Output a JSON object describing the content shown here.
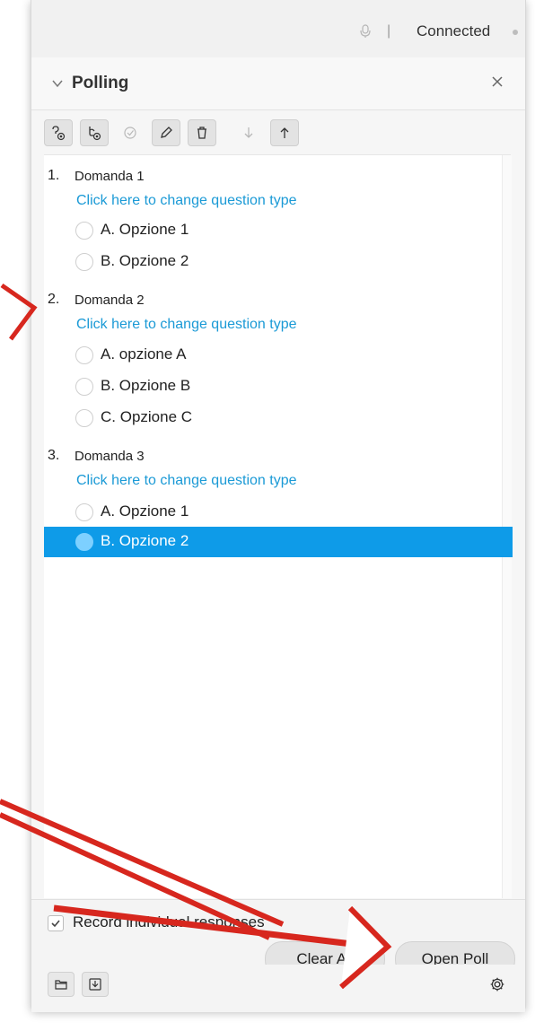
{
  "status": {
    "connection_label": "Connected",
    "separator": "|"
  },
  "header": {
    "title": "Polling"
  },
  "questions": [
    {
      "number": "1.",
      "text": "Domanda 1",
      "link": "Click here to change question type",
      "options": [
        "A. Opzione 1",
        "B. Opzione 2"
      ]
    },
    {
      "number": "2.",
      "text": "Domanda 2",
      "link": "Click here to change question type",
      "options": [
        "A. opzione A",
        "B. Opzione B",
        "C. Opzione C"
      ]
    },
    {
      "number": "3.",
      "text": "Domanda 3",
      "link": "Click here to change question type",
      "options": [
        "A. Opzione 1",
        "B. Opzione 2"
      ],
      "selected_option": "B. Opzione 2"
    }
  ],
  "footer": {
    "record_label": "Record individual responses",
    "record_checked": true,
    "clear_all_label": "Clear All",
    "open_poll_label": "Open Poll"
  },
  "colors": {
    "accent": "#0e9be8",
    "link": "#1b9ad6",
    "annotation_arrow": "#d7271e"
  },
  "icons": {
    "toolbar": [
      "add-question-icon",
      "add-poll-icon",
      "check-icon",
      "edit-icon",
      "delete-icon",
      "move-down-icon",
      "move-up-icon"
    ],
    "bottom": [
      "folder-icon",
      "save-icon",
      "settings-icon"
    ]
  }
}
